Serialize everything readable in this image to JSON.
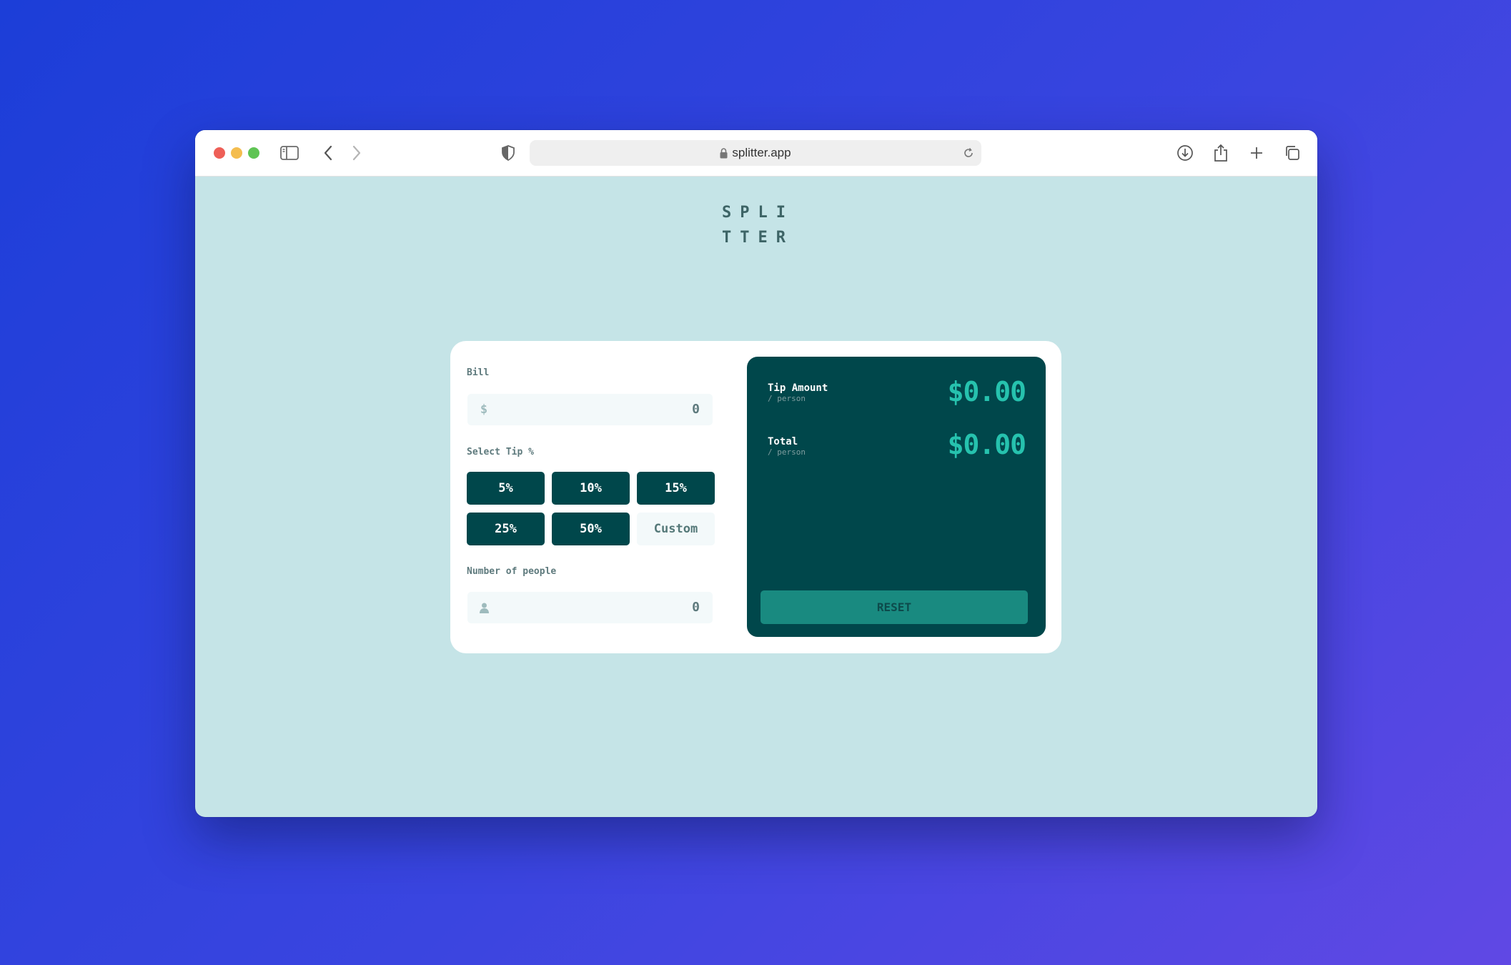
{
  "browser": {
    "url": "splitter.app"
  },
  "app": {
    "logo_line1": "SPLI",
    "logo_line2": "TTER"
  },
  "form": {
    "bill_label": "Bill",
    "bill_icon": "$",
    "bill_value": "0",
    "tip_label": "Select Tip %",
    "tip_options": [
      "5%",
      "10%",
      "15%",
      "25%",
      "50%"
    ],
    "custom_placeholder": "Custom",
    "people_label": "Number of people",
    "people_value": "0"
  },
  "results": {
    "tip_amount_label": "Tip Amount",
    "tip_amount_sub": "/ person",
    "tip_amount_value": "$0.00",
    "total_label": "Total",
    "total_sub": "/ person",
    "total_value": "$0.00",
    "reset_label": "RESET"
  },
  "colors": {
    "background_gradient_start": "#1c3ed8",
    "background_gradient_end": "#6048e4",
    "page_bg": "#c5e4e7",
    "dark_cyan": "#00474b",
    "accent": "#26c2ae",
    "reset_bg": "#198a80"
  }
}
